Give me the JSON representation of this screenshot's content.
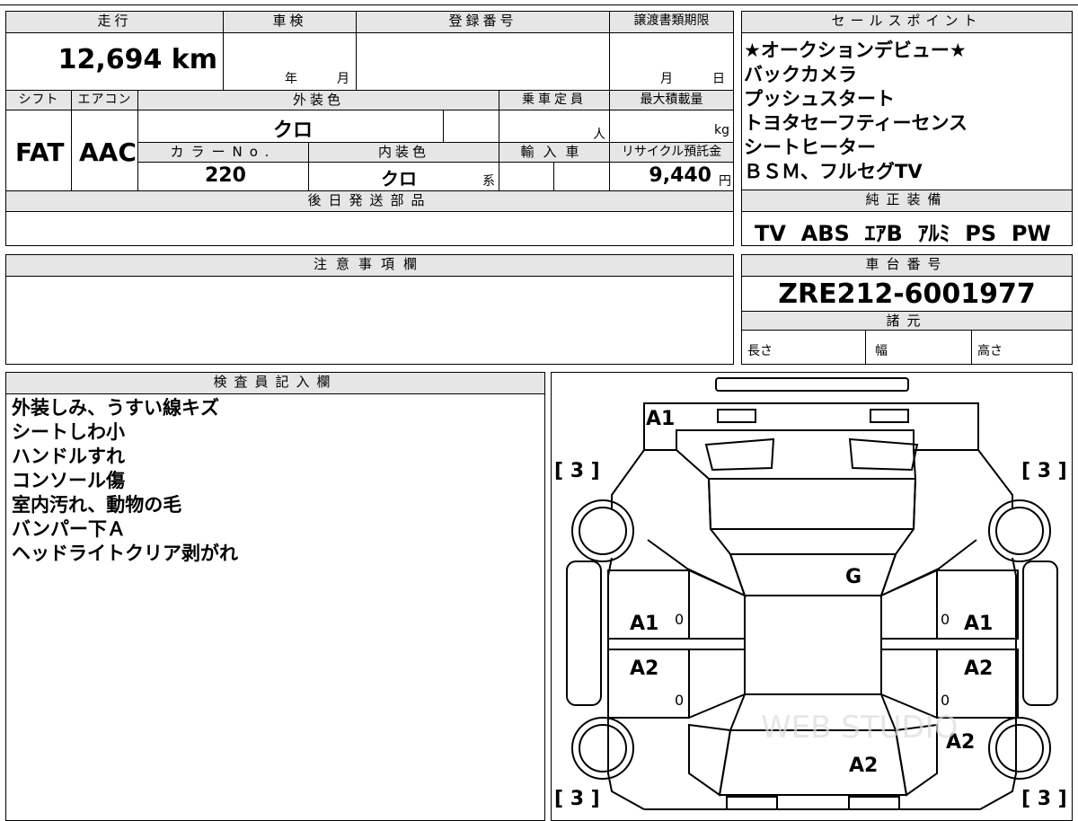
{
  "vehicle": {
    "mileage_label": "走行",
    "mileage": "12,694 km",
    "shaken_label": "車検",
    "shaken_year": "年",
    "shaken_month": "月",
    "reg_label": "登録番号",
    "transfer_label": "譲渡書類期限",
    "transfer_month": "月",
    "transfer_day": "日",
    "shift_label": "シフト",
    "shift": "FAT",
    "ac_label": "エアコン",
    "ac": "AAC",
    "exterior_label": "外装色",
    "exterior": "クロ",
    "capacity_label": "乗車定員",
    "capacity_unit": "人",
    "maxload_label": "最大積載量",
    "maxload_unit": "kg",
    "color_no_label": "カラーNo.",
    "color_no": "220",
    "interior_label": "内装色",
    "interior": "クロ",
    "interior_suffix": "系",
    "import_label": "輸入車",
    "recycle_label": "リサイクル預託金",
    "recycle": "9,440",
    "recycle_unit": "円",
    "later_parts_label": "後日発送部品"
  },
  "sales": {
    "label": "セールスポイント",
    "points": [
      "★オークションデビュー★",
      "バックカメラ",
      "プッシュスタート",
      "トヨタセーフティーセンス",
      "シートヒーター",
      "ＢＳＭ、フルセグTV"
    ]
  },
  "equipment": {
    "label": "純正装備",
    "items": "TV  ABS  ｴｱB  ｱﾙﾐ  PS  PW"
  },
  "notes": {
    "label": "注意事項欄"
  },
  "chassis": {
    "label": "車台番号",
    "number": "ZRE212-6001977"
  },
  "specs": {
    "label": "諸元",
    "length": "長さ",
    "width": "幅",
    "height": "高さ"
  },
  "inspector": {
    "label": "検査員記入欄",
    "lines": [
      "外装しみ、うすい線キズ",
      "シートしわ小",
      "ハンドルすれ",
      "コンソール傷",
      "室内汚れ、動物の毛",
      "バンパー下Ａ",
      "ヘッドライトクリア剥がれ"
    ]
  },
  "diagram": {
    "front_bumper": "A1",
    "tire_tl": "[ 3 ]",
    "tire_tr": "[ 3 ]",
    "tire_bl": "[ 3 ]",
    "tire_br": "[ 3 ]",
    "roof": "G",
    "door_fl": "A1",
    "door_fr": "A1",
    "door_rl": "A2",
    "door_rr": "A2",
    "quarter_r": "A2",
    "trunk": "A2",
    "zero": "0",
    "watermark": "WEB STUDIO"
  }
}
